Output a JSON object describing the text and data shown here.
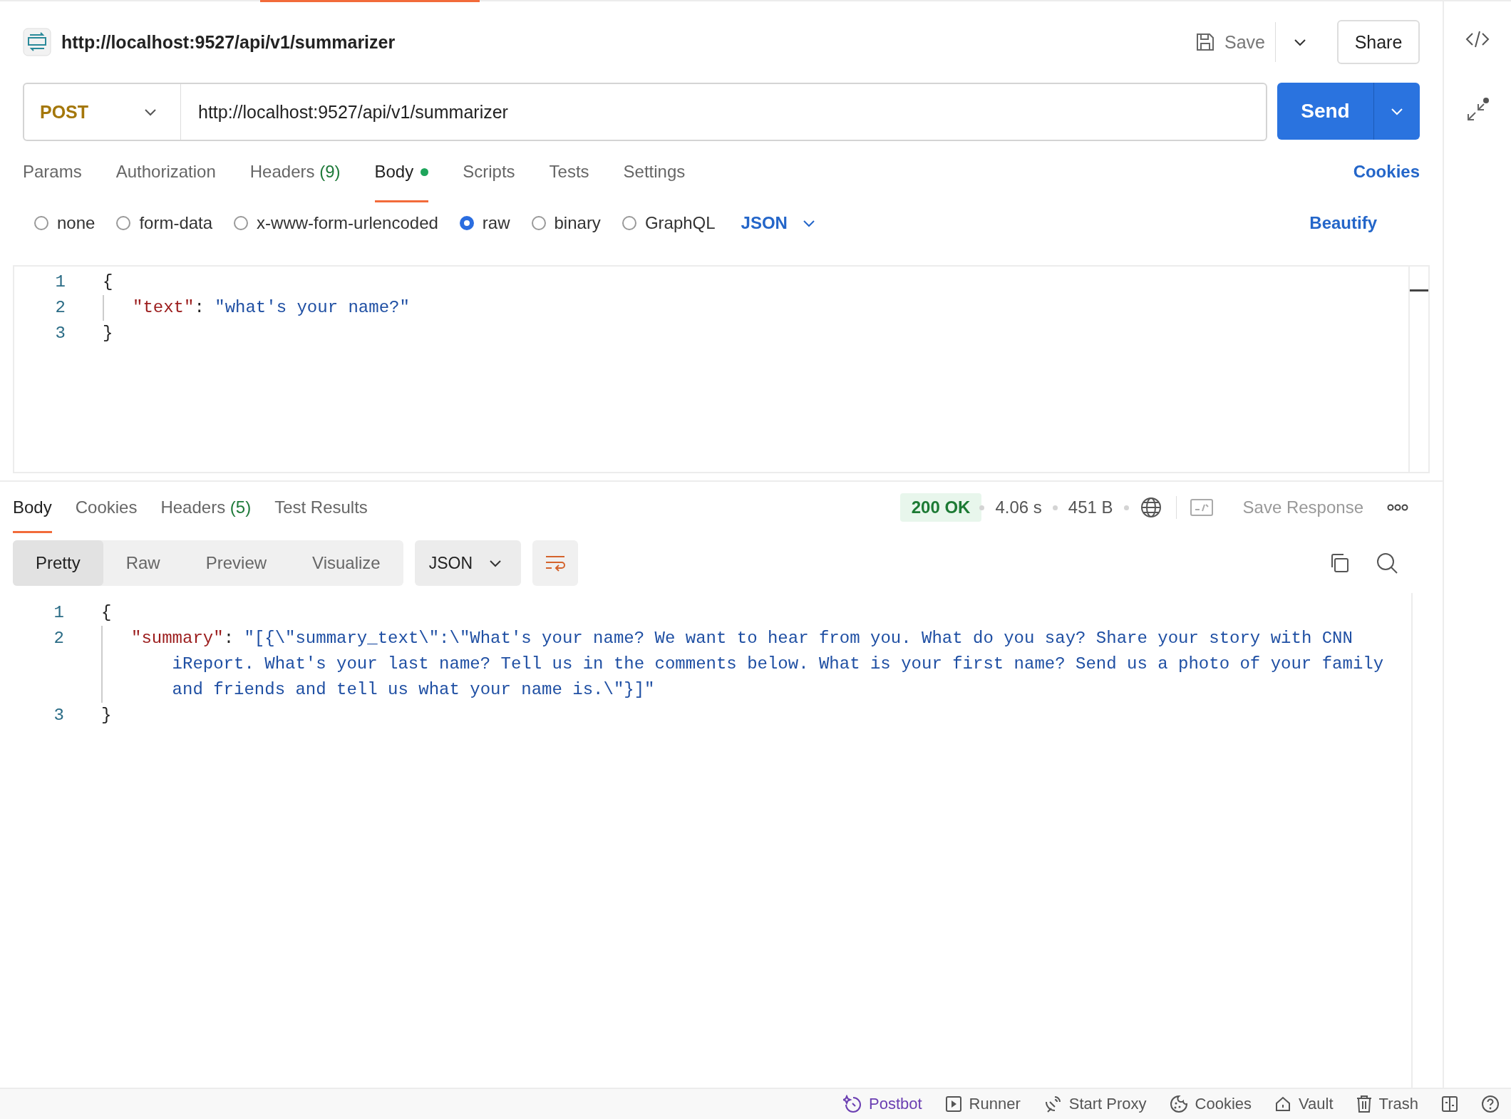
{
  "request": {
    "title": "http://localhost:9527/api/v1/summarizer",
    "save_label": "Save",
    "share_label": "Share",
    "method": "POST",
    "url": "http://localhost:9527/api/v1/summarizer",
    "send_label": "Send"
  },
  "request_tabs": [
    {
      "label": "Params",
      "selected": false,
      "modified": false
    },
    {
      "label": "Authorization",
      "selected": false,
      "modified": false
    },
    {
      "label": "Headers",
      "count": "(9)",
      "selected": false,
      "modified": false
    },
    {
      "label": "Body",
      "selected": true,
      "modified": true
    },
    {
      "label": "Scripts",
      "selected": false,
      "modified": false
    },
    {
      "label": "Tests",
      "selected": false,
      "modified": false
    },
    {
      "label": "Settings",
      "selected": false,
      "modified": false
    }
  ],
  "cookies_link": "Cookies",
  "body_types": [
    {
      "label": "none",
      "selected": false
    },
    {
      "label": "form-data",
      "selected": false
    },
    {
      "label": "x-www-form-urlencoded",
      "selected": false
    },
    {
      "label": "raw",
      "selected": true
    },
    {
      "label": "binary",
      "selected": false
    },
    {
      "label": "GraphQL",
      "selected": false
    }
  ],
  "body_language": "JSON",
  "beautify_label": "Beautify",
  "request_body": [
    {
      "number": "1",
      "text": "{"
    },
    {
      "number": "2",
      "key": "\"text\"",
      "sep": ": ",
      "value": "\"what's your name?\""
    },
    {
      "number": "3",
      "text": "}"
    }
  ],
  "response_tabs": [
    {
      "label": "Body",
      "selected": true
    },
    {
      "label": "Cookies",
      "selected": false
    },
    {
      "label": "Headers",
      "count": "(5)",
      "selected": false
    },
    {
      "label": "Test Results",
      "selected": false
    }
  ],
  "response_meta": {
    "status": "200 OK",
    "time": "4.06 s",
    "size": "451 B",
    "save_response": "Save Response"
  },
  "view_modes": [
    {
      "label": "Pretty",
      "selected": true
    },
    {
      "label": "Raw",
      "selected": false
    },
    {
      "label": "Preview",
      "selected": false
    },
    {
      "label": "Visualize",
      "selected": false
    }
  ],
  "response_language": "JSON",
  "response_body": [
    {
      "number": "1",
      "text": "{"
    },
    {
      "number": "2",
      "key": "\"summary\"",
      "sep": ": ",
      "value": "\"[{\\\"summary_text\\\":\\\"What's your name? We want to hear from you. What do you say? Share your story with CNN iReport. What's your last name? Tell us in the comments below. What is your first name? Send us a photo of your family and friends and tell us what your name is.\\\"}]\""
    },
    {
      "number": "3",
      "text": "}"
    }
  ],
  "status_bar": [
    {
      "kind": "postbot",
      "label": "Postbot"
    },
    {
      "kind": "runner",
      "label": "Runner"
    },
    {
      "kind": "proxy",
      "label": "Start Proxy"
    },
    {
      "kind": "cookies",
      "label": "Cookies"
    },
    {
      "kind": "vault",
      "label": "Vault"
    },
    {
      "kind": "trash",
      "label": "Trash"
    },
    {
      "kind": "layout"
    },
    {
      "kind": "help"
    }
  ]
}
